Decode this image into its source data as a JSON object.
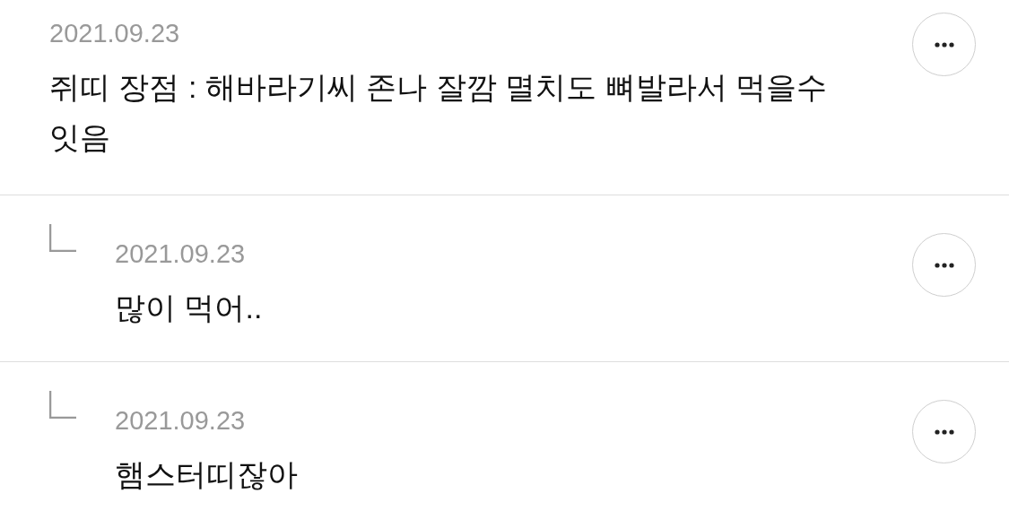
{
  "comments": [
    {
      "kind": "comment",
      "date": "2021.09.23",
      "text": "쥐띠 장점 : 해바라기씨 존나 잘깜 멸치도 뼈발라서 먹을수 잇음"
    },
    {
      "kind": "reply",
      "date": "2021.09.23",
      "text": "많이 먹어.."
    },
    {
      "kind": "reply",
      "date": "2021.09.23",
      "text": "햄스터띠잖아"
    }
  ]
}
